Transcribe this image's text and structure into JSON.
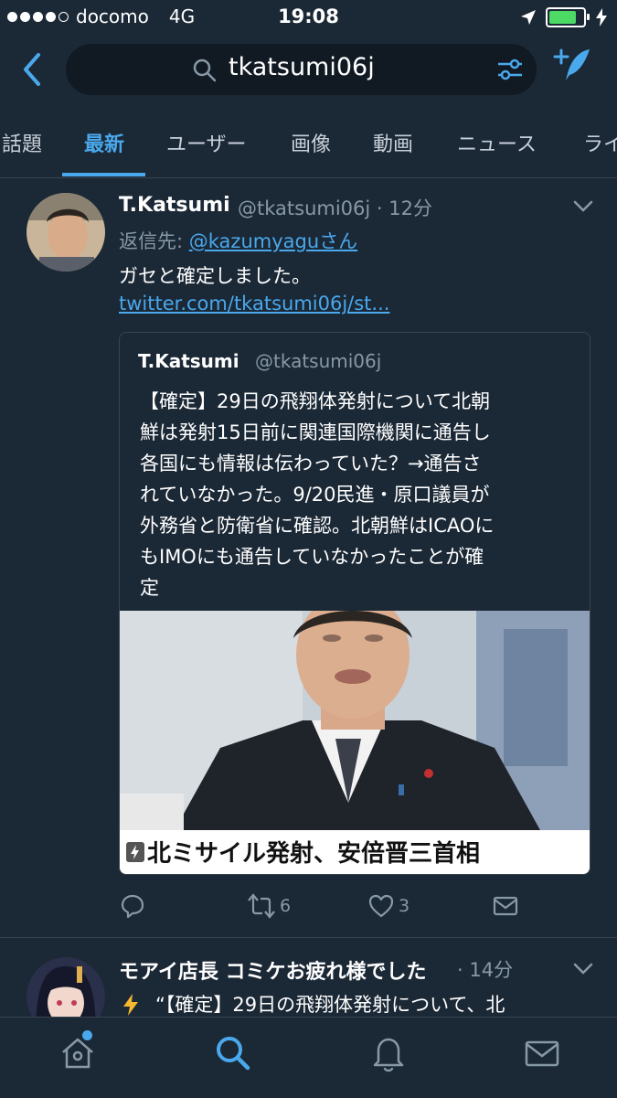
{
  "status_bar": {
    "carrier": "docomo",
    "network": "4G",
    "time": "19:08",
    "signal_bars_filled": 4,
    "signal_bars_total": 5,
    "battery_level": 0.9
  },
  "header": {
    "search_query": "tkatsumi06j",
    "icons": [
      "back-chevron-icon",
      "search-icon",
      "filter-sliders-icon",
      "compose-tweet-icon"
    ]
  },
  "tabs": [
    "話題",
    "最新",
    "ユーザー",
    "画像",
    "動画",
    "ニュース",
    "ライ"
  ],
  "active_tab": "最新",
  "tweet": {
    "display_name": "T.Katsumi",
    "handle": "@tkatsumi06j",
    "time_ago": "12分",
    "reply_prefix": "返信先:",
    "reply_to": "@kazumyaguさん",
    "text": "ガセと確定しました。",
    "link": "twitter.com/tkatsumi06j/st...",
    "quoted": {
      "display_name": "T.Katsumi",
      "handle": "@tkatsumi06j",
      "lines": [
        "【確定】29日の飛翔体発射について北朝",
        "鮮は発射15日前に関連国際機関に通告し",
        "各国にも情報は伝わっていた？→通告さ",
        "れていなかった。9/20民進・原口議員が",
        "外務省と防衛省に確認。北朝鮮はICAOに",
        "もIMOにも通告していなかったことが確",
        "定"
      ],
      "card_caption": "北ミサイル発射、安倍晋三首相"
    },
    "actions": {
      "reply_count": "",
      "retweet_count": "6",
      "like_count": "3"
    }
  },
  "tweet2": {
    "display_name": "モアイ店長  コミケお疲れ様でした",
    "time_ago": "14分",
    "text_preview": "“【確定】29日の飛翔体発射について、北"
  },
  "tab_bar": {
    "items": [
      "home-icon",
      "search-icon",
      "notifications-bell-icon",
      "messages-envelope-icon"
    ],
    "active": "search-icon"
  },
  "colors": {
    "background": "#1b2836",
    "accent": "#4aa8ec",
    "secondary_text": "#8899a6",
    "divider": "#38444d"
  }
}
